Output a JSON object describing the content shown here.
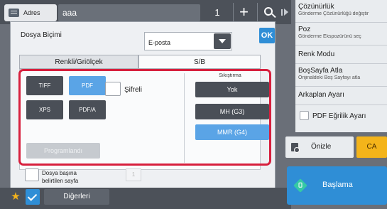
{
  "topbar": {
    "address_label": "Adres",
    "address_value": "aaa",
    "copies": "1",
    "plus_label": "+"
  },
  "dialog": {
    "file_format_label": "Dosya Biçimi",
    "destination_value": "E-posta",
    "ok_label": "OK",
    "tabs": [
      {
        "label": "Renkli/Griölçek",
        "active": false
      },
      {
        "label": "S/B",
        "active": true
      }
    ],
    "formats": [
      {
        "label": "TIFF",
        "selected": false
      },
      {
        "label": "PDF",
        "selected": true
      },
      {
        "label": "XPS",
        "selected": false
      },
      {
        "label": "PDF/A",
        "selected": false
      }
    ],
    "encrypted_label": "Şifreli",
    "encrypted_checked": false,
    "programmed_label": "Programlandı",
    "compression_title": "Sıkıştırma",
    "compression_options": [
      {
        "label": "Yok",
        "selected": false
      },
      {
        "label": "MH (G3)",
        "selected": false
      },
      {
        "label": "MMR (G4)",
        "selected": true
      }
    ],
    "file_per_page_label_line1": "Dosya başına",
    "file_per_page_label_line2": "belirtilen sayfa",
    "file_per_page_value": "1",
    "highlight_color": "#d71f3d"
  },
  "bottombar": {
    "others_label": "Diğerleri"
  },
  "right_panel": {
    "items": [
      {
        "title": "Çözünürlük",
        "subtitle": "Gönderme Çözünürlüğü değiştir"
      },
      {
        "title": "Poz",
        "subtitle": "Gönderme Ekspozürünü seç"
      },
      {
        "title": "Renk Modu",
        "subtitle": ""
      },
      {
        "title": "BoşSayfa Atla",
        "subtitle": "Orijinaldeki Boş Sayfayı atla"
      },
      {
        "title": "Arkaplan Ayarı",
        "subtitle": ""
      },
      {
        "title": "PDF Eğrilik Ayarı",
        "subtitle": ""
      }
    ],
    "preview_label": "Önizle",
    "ca_label": "CA",
    "start_label": "Başlama"
  },
  "colors": {
    "accent_blue": "#2f8ed6",
    "selected_blue": "#5aa4e6",
    "dark_button": "#4a4f57",
    "ca_yellow": "#f4b41a",
    "start_icon_green": "#35c9a5",
    "favorite_star": "#f3b21c"
  }
}
